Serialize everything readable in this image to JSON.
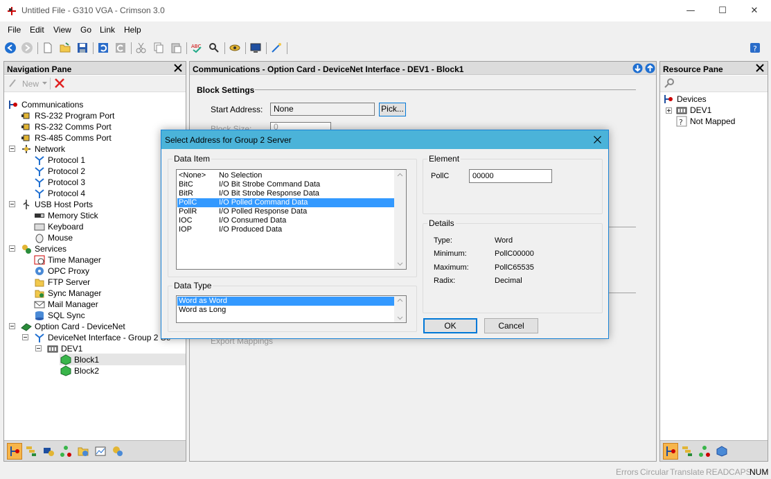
{
  "window": {
    "title": "Untitled File - G310 VGA - Crimson 3.0",
    "minimize": "—",
    "maximize": "☐",
    "close": "✕"
  },
  "menu": [
    "File",
    "Edit",
    "View",
    "Go",
    "Link",
    "Help"
  ],
  "nav_pane": {
    "title": "Navigation Pane",
    "new_label": "New",
    "tree": [
      {
        "label": "Communications",
        "icon": "communications-icon"
      },
      {
        "label": "RS-232 Program Port",
        "icon": "port-icon"
      },
      {
        "label": "RS-232 Comms Port",
        "icon": "port-icon"
      },
      {
        "label": "RS-485 Comms Port",
        "icon": "port-icon"
      },
      {
        "label": "Network",
        "icon": "network-icon"
      },
      {
        "label": "Protocol 1",
        "icon": "protocol-icon"
      },
      {
        "label": "Protocol 2",
        "icon": "protocol-icon"
      },
      {
        "label": "Protocol 3",
        "icon": "protocol-icon"
      },
      {
        "label": "Protocol 4",
        "icon": "protocol-icon"
      },
      {
        "label": "USB Host Ports",
        "icon": "usb-icon"
      },
      {
        "label": "Memory Stick",
        "icon": "memory-stick-icon"
      },
      {
        "label": "Keyboard",
        "icon": "keyboard-icon"
      },
      {
        "label": "Mouse",
        "icon": "mouse-icon"
      },
      {
        "label": "Services",
        "icon": "services-icon"
      },
      {
        "label": "Time Manager",
        "icon": "time-manager-icon"
      },
      {
        "label": "OPC Proxy",
        "icon": "opc-proxy-icon"
      },
      {
        "label": "FTP Server",
        "icon": "ftp-server-icon"
      },
      {
        "label": "Sync Manager",
        "icon": "sync-manager-icon"
      },
      {
        "label": "Mail Manager",
        "icon": "mail-manager-icon"
      },
      {
        "label": "SQL Sync",
        "icon": "sql-sync-icon"
      },
      {
        "label": "Option Card - DeviceNet",
        "icon": "option-card-icon"
      },
      {
        "label": "DeviceNet Interface - Group 2 Se",
        "icon": "devicenet-icon"
      },
      {
        "label": "DEV1",
        "icon": "device-icon"
      },
      {
        "label": "Block1",
        "icon": "block-icon"
      },
      {
        "label": "Block2",
        "icon": "block-icon"
      }
    ]
  },
  "main_pane": {
    "title": "Communications - Option Card - DeviceNet Interface - DEV1 - Block1",
    "block_settings": "Block Settings",
    "start_address_label": "Start Address:",
    "start_address_value": "None",
    "pick_button": "Pick...",
    "block_size_label": "Block Size:",
    "block_size_value": "0",
    "export_mappings": "Export Mappings"
  },
  "resource_pane": {
    "title": "Resource Pane",
    "tree": [
      {
        "label": "Devices"
      },
      {
        "label": "DEV1"
      },
      {
        "label": "Not Mapped"
      }
    ]
  },
  "dialog": {
    "title": "Select Address for Group 2 Server",
    "data_item_label": "Data Item",
    "data_items": [
      {
        "code": "<None>",
        "desc": "No Selection"
      },
      {
        "code": "BitC",
        "desc": "I/O Bit Strobe Command Data"
      },
      {
        "code": "BitR",
        "desc": "I/O Bit Strobe Response Data"
      },
      {
        "code": "PollC",
        "desc": "I/O Polled Command Data"
      },
      {
        "code": "PollR",
        "desc": "I/O Polled Response Data"
      },
      {
        "code": "IOC",
        "desc": "I/O Consumed Data"
      },
      {
        "code": "IOP",
        "desc": "I/O Produced Data"
      }
    ],
    "selected_item_index": 3,
    "element_label": "Element",
    "element_name": "PollC",
    "element_value": "00000",
    "details_label": "Details",
    "details": [
      {
        "key": "Type:",
        "value": "Word"
      },
      {
        "key": "Minimum:",
        "value": "PollC00000"
      },
      {
        "key": "Maximum:",
        "value": "PollC65535"
      },
      {
        "key": "Radix:",
        "value": "Decimal"
      }
    ],
    "data_type_label": "Data Type",
    "data_types": [
      "Word as Word",
      "Word as Long"
    ],
    "selected_type_index": 0,
    "ok": "OK",
    "cancel": "Cancel"
  },
  "status": [
    "Errors",
    "Circular",
    "Translate",
    "READ",
    "CAPS",
    "NUM"
  ],
  "colors": {
    "dialog_title": "#4bb3d9",
    "selection": "#3399ff",
    "accent": "#0078d7"
  }
}
